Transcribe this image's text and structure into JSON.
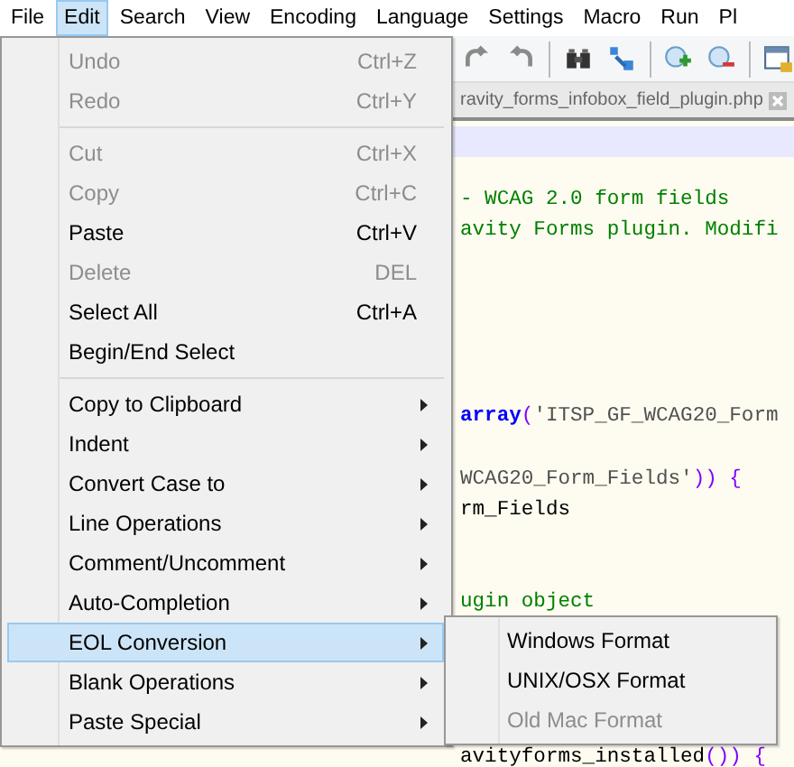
{
  "menubar": [
    {
      "label": "File",
      "selected": false
    },
    {
      "label": "Edit",
      "selected": true
    },
    {
      "label": "Search",
      "selected": false
    },
    {
      "label": "View",
      "selected": false
    },
    {
      "label": "Encoding",
      "selected": false
    },
    {
      "label": "Language",
      "selected": false
    },
    {
      "label": "Settings",
      "selected": false
    },
    {
      "label": "Macro",
      "selected": false
    },
    {
      "label": "Run",
      "selected": false
    },
    {
      "label": "Pl",
      "selected": false
    }
  ],
  "tab": {
    "title": "ravity_forms_infobox_field_plugin.php"
  },
  "code_lines": [
    {
      "kind": "current"
    },
    {
      "kind": "blank"
    },
    {
      "kind": "text",
      "segments": [
        {
          "text": "- WCAG 2.0 form fields",
          "kind": "comment"
        }
      ]
    },
    {
      "kind": "text",
      "segments": [
        {
          "text": "avity Forms plugin. Modifi",
          "kind": "comment"
        }
      ]
    },
    {
      "kind": "blank"
    },
    {
      "kind": "blank"
    },
    {
      "kind": "blank"
    },
    {
      "kind": "blank"
    },
    {
      "kind": "blank"
    },
    {
      "kind": "text",
      "segments": [
        {
          "text": "array",
          "kind": "keyword"
        },
        {
          "text": "(",
          "kind": "operator"
        },
        {
          "text": "'ITSP_GF_WCAG20_Form",
          "kind": "string"
        }
      ]
    },
    {
      "kind": "blank"
    },
    {
      "kind": "text",
      "segments": [
        {
          "text": "WCAG20_Form_Fields'",
          "kind": "string"
        },
        {
          "text": ")) {",
          "kind": "operator"
        }
      ]
    },
    {
      "kind": "text",
      "segments": [
        {
          "text": "rm_Fields",
          "kind": "plain"
        }
      ]
    },
    {
      "kind": "blank"
    },
    {
      "kind": "blank"
    },
    {
      "kind": "text",
      "segments": [
        {
          "text": "ugin object",
          "kind": "comment"
        }
      ]
    },
    {
      "kind": "blank"
    },
    {
      "kind": "blank"
    },
    {
      "kind": "blank"
    },
    {
      "kind": "blank"
    },
    {
      "kind": "text",
      "segments": [
        {
          "text": "avityforms_installed",
          "kind": "plain"
        },
        {
          "text": "()) {",
          "kind": "operator"
        }
      ]
    }
  ],
  "menu": {
    "groups": [
      [
        {
          "label": "Undo",
          "shortcut": "Ctrl+Z",
          "kind": "command",
          "disabled": true,
          "selected": false
        },
        {
          "label": "Redo",
          "shortcut": "Ctrl+Y",
          "kind": "command",
          "disabled": true,
          "selected": false
        }
      ],
      [
        {
          "label": "Cut",
          "shortcut": "Ctrl+X",
          "kind": "command",
          "disabled": true,
          "selected": false
        },
        {
          "label": "Copy",
          "shortcut": "Ctrl+C",
          "kind": "command",
          "disabled": true,
          "selected": false
        },
        {
          "label": "Paste",
          "shortcut": "Ctrl+V",
          "kind": "command",
          "disabled": false,
          "selected": false
        },
        {
          "label": "Delete",
          "shortcut": "DEL",
          "kind": "command",
          "disabled": true,
          "selected": false
        },
        {
          "label": "Select All",
          "shortcut": "Ctrl+A",
          "kind": "command",
          "disabled": false,
          "selected": false
        },
        {
          "label": "Begin/End Select",
          "kind": "command",
          "disabled": false,
          "selected": false
        }
      ],
      [
        {
          "label": "Copy to Clipboard",
          "kind": "submenu",
          "disabled": false,
          "selected": false
        },
        {
          "label": "Indent",
          "kind": "submenu",
          "disabled": false,
          "selected": false
        },
        {
          "label": "Convert Case to",
          "kind": "submenu",
          "disabled": false,
          "selected": false
        },
        {
          "label": "Line Operations",
          "kind": "submenu",
          "disabled": false,
          "selected": false
        },
        {
          "label": "Comment/Uncomment",
          "kind": "submenu",
          "disabled": false,
          "selected": false
        },
        {
          "label": "Auto-Completion",
          "kind": "submenu",
          "disabled": false,
          "selected": false
        },
        {
          "label": "EOL Conversion",
          "kind": "submenu",
          "disabled": false,
          "selected": true
        },
        {
          "label": "Blank Operations",
          "kind": "submenu",
          "disabled": false,
          "selected": false
        },
        {
          "label": "Paste Special",
          "kind": "submenu",
          "disabled": false,
          "selected": false
        }
      ]
    ]
  },
  "submenu": {
    "items": [
      {
        "label": "Windows Format",
        "disabled": false
      },
      {
        "label": "UNIX/OSX Format",
        "disabled": false
      },
      {
        "label": "Old Mac Format",
        "disabled": true
      }
    ]
  }
}
